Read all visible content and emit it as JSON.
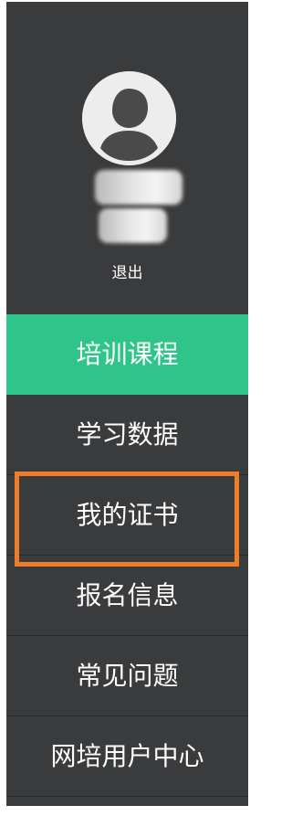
{
  "profile": {
    "avatar_icon": "user-avatar-icon",
    "logout_label": "退出"
  },
  "nav": {
    "items": [
      {
        "label": "培训课程",
        "active": true
      },
      {
        "label": "学习数据",
        "active": false
      },
      {
        "label": "我的证书",
        "active": false,
        "highlighted": true
      },
      {
        "label": "报名信息",
        "active": false
      },
      {
        "label": "常见问题",
        "active": false
      },
      {
        "label": "网培用户中心",
        "active": false
      }
    ]
  },
  "colors": {
    "sidebar_bg": "#3a3b3d",
    "active_item": "#2ec48a",
    "highlight_border": "#ee7d2a",
    "avatar_bg": "#ededed",
    "avatar_figure": "#4a4a4a"
  }
}
